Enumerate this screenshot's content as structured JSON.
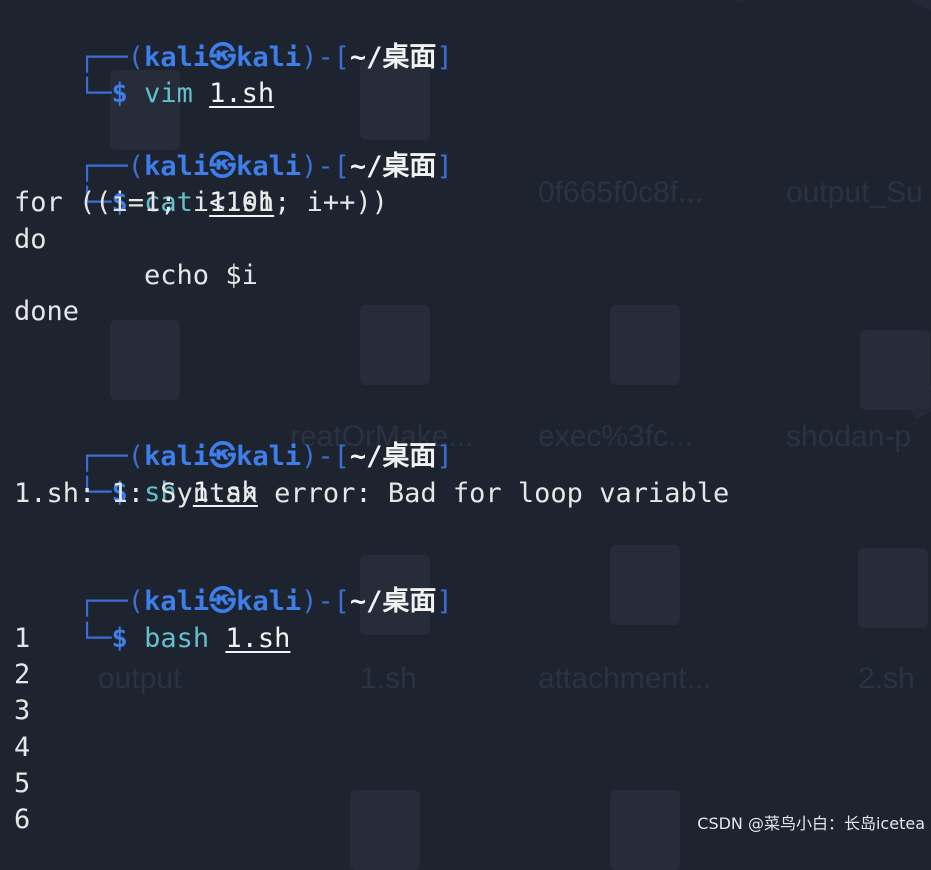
{
  "desktop": {
    "icon_labels": [
      "0f665f0c8f...",
      "output_Su",
      "reatOrMake...",
      "exec%3fc...",
      "shodan-p",
      "output",
      "1.sh",
      "attachment...",
      "2.sh"
    ]
  },
  "prompt": {
    "frame_open": "┌──(",
    "user": "kali",
    "at_symbol": "㉿",
    "host": "kali",
    "frame_mid": ")-[",
    "dir": "~/桌面",
    "frame_close": "]",
    "corner": "└─",
    "dollar": "$"
  },
  "blocks": [
    {
      "cmd": "vim",
      "arg": "1.sh",
      "output": []
    },
    {
      "cmd": "cat",
      "arg": "1.sh",
      "output": [
        "for ((i=1; i<101; i++))",
        "do",
        "        echo $i",
        "done"
      ]
    },
    {
      "cmd": "sh",
      "arg": "1.sh",
      "output": [
        "1.sh: 1: Syntax error: Bad for loop variable"
      ]
    },
    {
      "cmd": "bash",
      "arg": "1.sh",
      "output": [
        "1",
        "2",
        "3",
        "4",
        "5",
        "6"
      ]
    }
  ],
  "watermark": "CSDN @菜鸟小白：长岛icetea"
}
